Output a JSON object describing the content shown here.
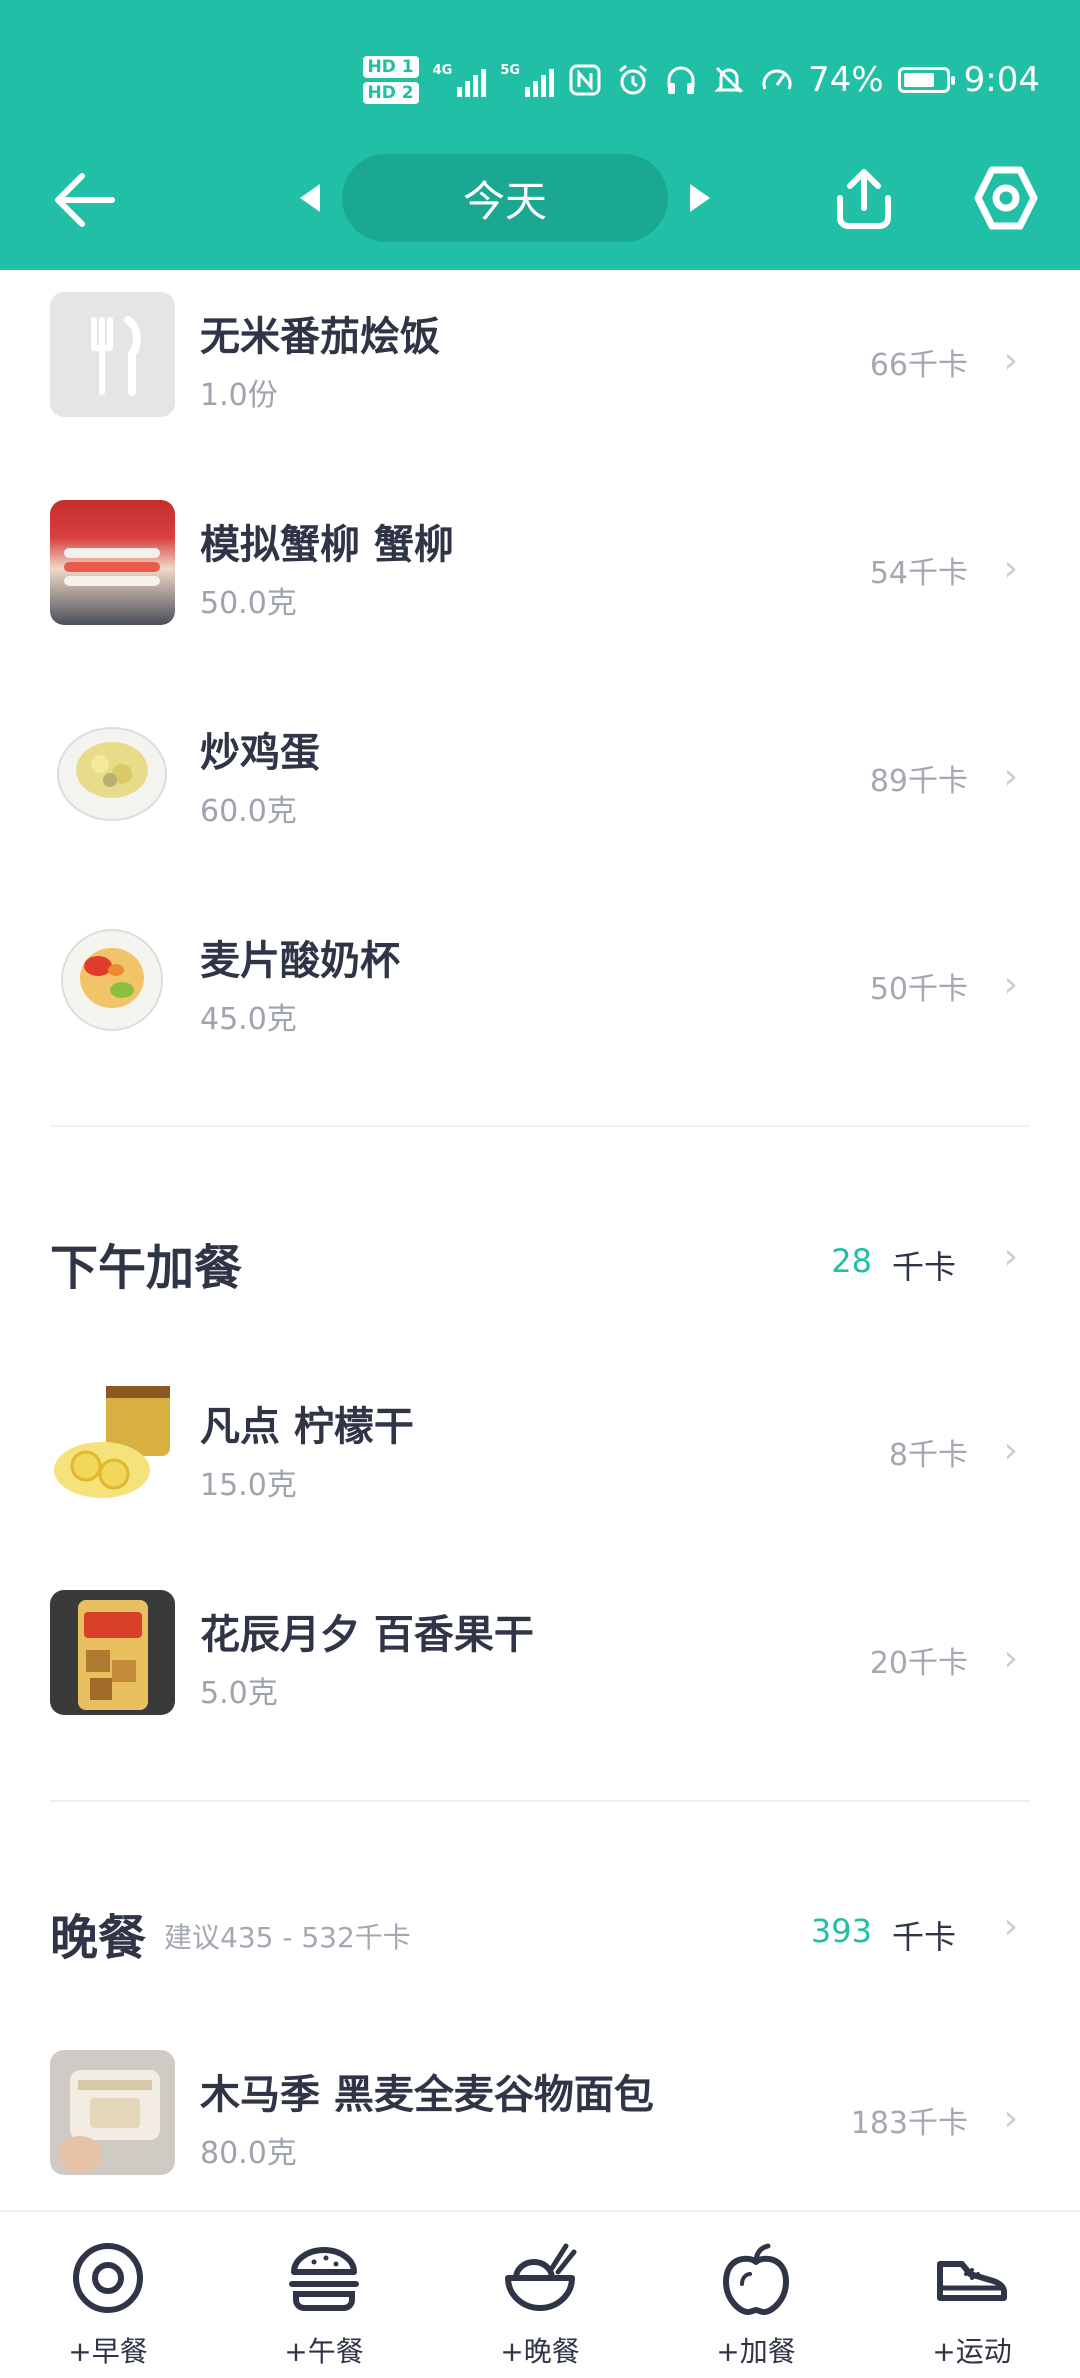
{
  "status_bar": {
    "hd1": "HD 1",
    "hd2": "HD 2",
    "net1": "4G",
    "net2": "5G",
    "battery_pct": "74%",
    "battery_level": 0.74,
    "time": "9:04"
  },
  "header": {
    "date_label": "今天",
    "accent_color": "#20bfa6"
  },
  "meals": {
    "breakfast_items": [
      {
        "name": "无米番茄烩饭",
        "qty": "1.0份",
        "kcal": "66千卡",
        "icon": "fork-knife-icon"
      },
      {
        "name": "模拟蟹柳 蟹柳",
        "qty": "50.0克",
        "kcal": "54千卡",
        "icon": "crab-stick-photo"
      },
      {
        "name": "炒鸡蛋",
        "qty": "60.0克",
        "kcal": "89千卡",
        "icon": "scrambled-egg-photo"
      },
      {
        "name": "麦片酸奶杯",
        "qty": "45.0克",
        "kcal": "50千卡",
        "icon": "yogurt-cup-photo"
      }
    ],
    "snack": {
      "title": "下午加餐",
      "total": "28",
      "unit": "千卡",
      "items": [
        {
          "name": "凡点 柠檬干",
          "qty": "15.0克",
          "kcal": "8千卡",
          "icon": "dried-lemon-photo"
        },
        {
          "name": "花辰月夕 百香果干",
          "qty": "5.0克",
          "kcal": "20千卡",
          "icon": "passion-fruit-photo"
        }
      ]
    },
    "dinner": {
      "title": "晚餐",
      "advice": "建议435 - 532千卡",
      "total": "393",
      "unit": "千卡",
      "items": [
        {
          "name": "木马季 黑麦全麦谷物面包",
          "qty": "80.0克",
          "kcal": "183千卡",
          "icon": "bread-photo"
        }
      ]
    }
  },
  "bottom_nav": [
    {
      "label": "+早餐",
      "icon": "egg-icon"
    },
    {
      "label": "+午餐",
      "icon": "burger-icon"
    },
    {
      "label": "+晚餐",
      "icon": "bowl-icon"
    },
    {
      "label": "+加餐",
      "icon": "apple-icon"
    },
    {
      "label": "+运动",
      "icon": "sneaker-icon"
    }
  ]
}
